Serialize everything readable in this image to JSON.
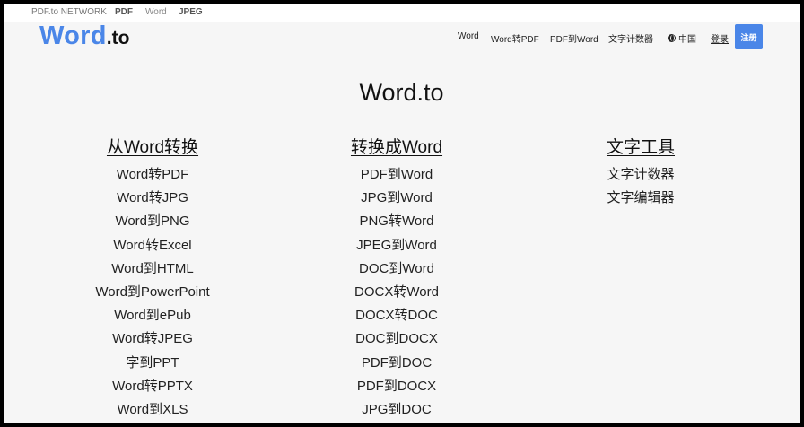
{
  "network": {
    "label": "PDF.to NETWORK",
    "links": [
      "PDF",
      "Word",
      "JPEG"
    ]
  },
  "logo": {
    "word": "Word",
    "suffix": ".to"
  },
  "nav": {
    "items": [
      "Word",
      "Word转PDF",
      "PDF到Word",
      "文字计数器"
    ],
    "language": "中国",
    "language_icon": "globe-icon",
    "login": "登录",
    "register": "注册"
  },
  "hero": {
    "title": "Word.to"
  },
  "columns": {
    "from_word": {
      "heading": "从Word转换",
      "items": [
        "Word转PDF",
        "Word转JPG",
        "Word到PNG",
        "Word转Excel",
        "Word到HTML",
        "Word到PowerPoint",
        "Word到ePub",
        "Word转JPEG",
        "字到PPT",
        "Word转PPTX",
        "Word到XLS"
      ]
    },
    "to_word": {
      "heading": "转换成Word",
      "items": [
        "PDF到Word",
        "JPG到Word",
        "PNG转Word",
        "JPEG到Word",
        "DOC到Word",
        "DOCX转Word",
        "DOCX转DOC",
        "DOC到DOCX",
        "PDF到DOC",
        "PDF到DOCX",
        "JPG到DOC"
      ]
    },
    "text_tools": {
      "heading": "文字工具",
      "items": [
        "文字计数器",
        "文字编辑器"
      ]
    }
  },
  "colors": {
    "brand": "#4a86e8",
    "background": "#f6f6f6",
    "text": "#222222"
  }
}
